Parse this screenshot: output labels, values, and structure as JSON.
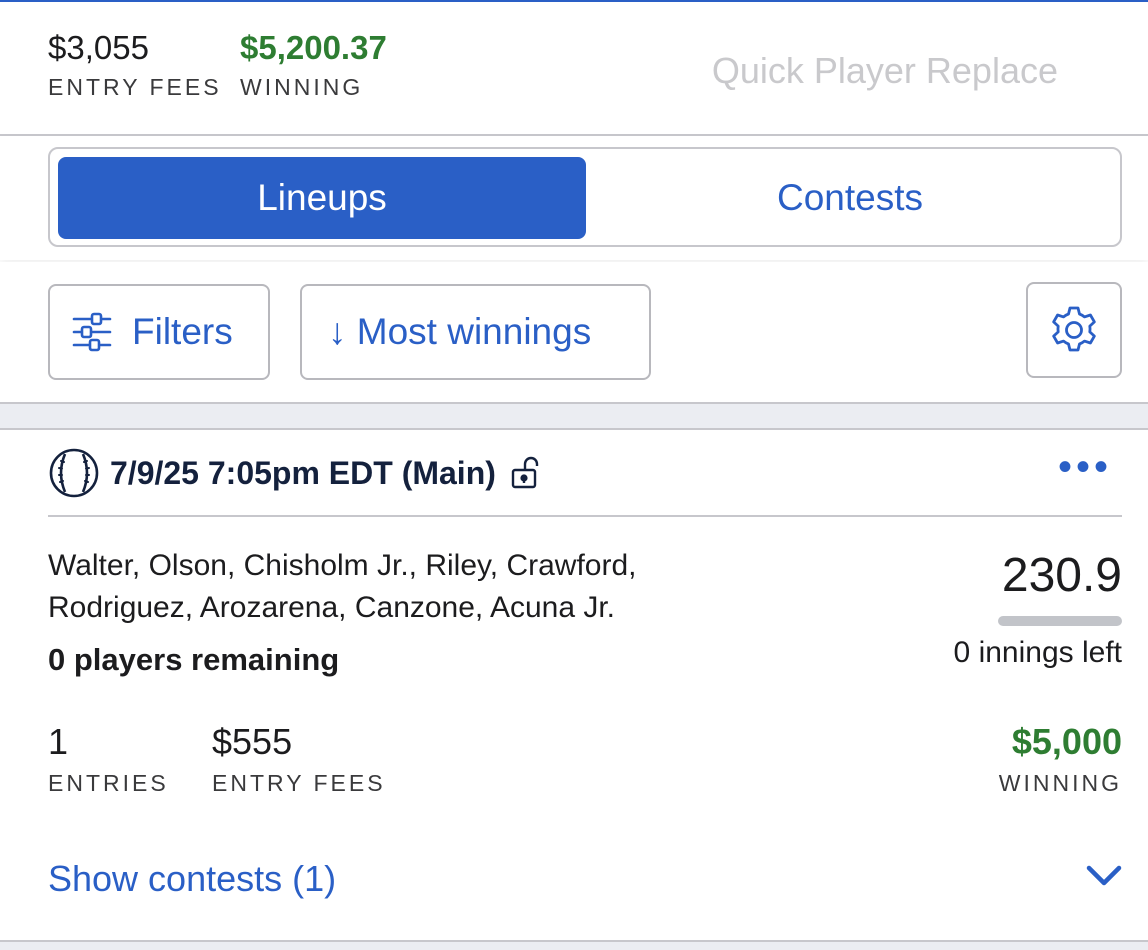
{
  "summary": {
    "entry_fees_value": "$3,055",
    "entry_fees_label": "ENTRY FEES",
    "winning_value": "$5,200.37",
    "winning_label": "WINNING",
    "quick_replace_label": "Quick Player Replace"
  },
  "tabs": {
    "active": "Lineups",
    "inactive": "Contests"
  },
  "toolbar": {
    "filters_label": "Filters",
    "sort_label": "↓ Most winnings",
    "icons": {
      "filters": "sliders-icon",
      "settings": "gear-icon"
    }
  },
  "lineup_card": {
    "sport_icon": "baseball-icon",
    "slate_title": "7/9/25 7:05pm EDT (Main)",
    "lock_icon": "unlocked-padlock-icon",
    "more_label": "•••",
    "players_line1": "Walter, Olson, Chisholm Jr., Riley, Crawford,",
    "players_line2": "Rodriguez, Arozarena, Canzone, Acuna Jr.",
    "remaining_text": "0 players remaining",
    "score": "230.9",
    "innings_left": "0 innings left",
    "entries_value": "1",
    "entries_label": "ENTRIES",
    "entry_fees_value": "$555",
    "entry_fees_label": "ENTRY FEES",
    "winning_value": "$5,000",
    "winning_label": "WINNING",
    "show_contests_label": "Show contests (1)",
    "expand_icon": "chevron-down-icon"
  },
  "colors": {
    "accent": "#2a5fc6",
    "positive": "#2e7d32",
    "navy": "#14213d",
    "muted": "#c9c9cc"
  }
}
